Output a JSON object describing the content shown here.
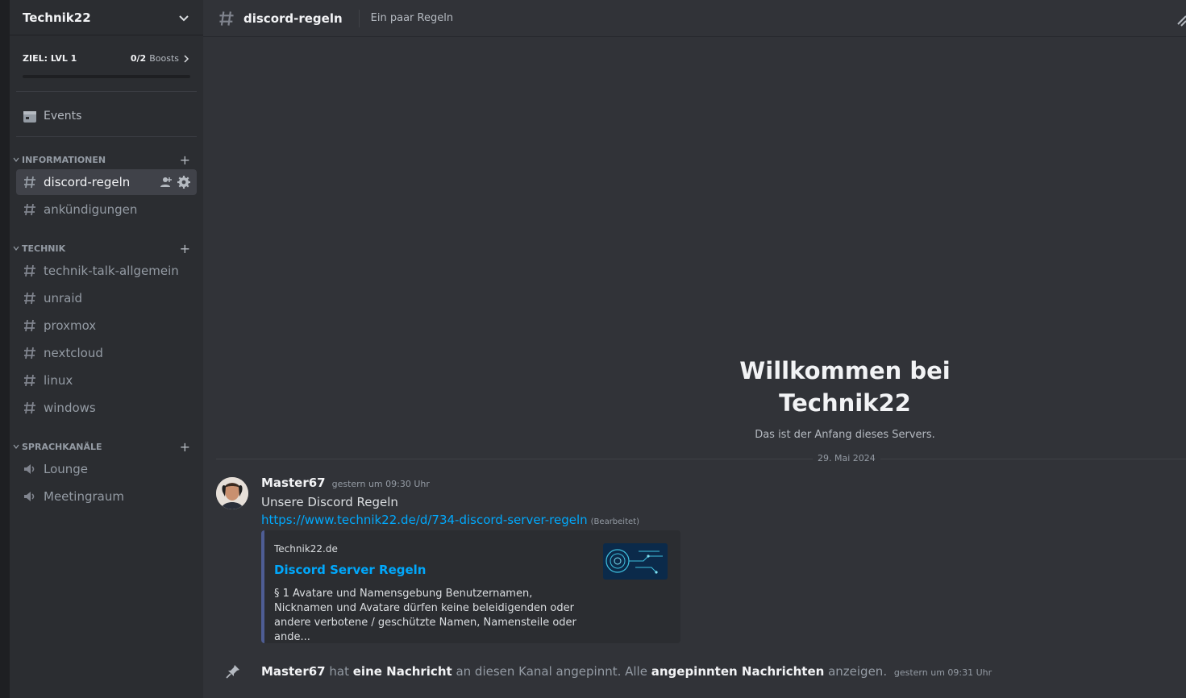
{
  "server": {
    "name": "Technik22",
    "boost_goal": "ZIEL: LVL 1",
    "boost_count": "0/2",
    "boost_unit": "Boosts",
    "boost_progress": 0
  },
  "sidebar": {
    "events_label": "Events",
    "categories": [
      {
        "name": "INFORMATIONEN",
        "channels": [
          {
            "name": "discord-regeln",
            "type": "text",
            "active": true
          },
          {
            "name": "ankündigungen",
            "type": "text",
            "active": false
          }
        ]
      },
      {
        "name": "TECHNIK",
        "channels": [
          {
            "name": "technik-talk-allgemein",
            "type": "text"
          },
          {
            "name": "unraid",
            "type": "text"
          },
          {
            "name": "proxmox",
            "type": "text"
          },
          {
            "name": "nextcloud",
            "type": "text"
          },
          {
            "name": "linux",
            "type": "text"
          },
          {
            "name": "windows",
            "type": "text"
          }
        ]
      },
      {
        "name": "SPRACHKANÄLE",
        "channels": [
          {
            "name": "Lounge",
            "type": "voice"
          },
          {
            "name": "Meetingraum",
            "type": "voice"
          }
        ]
      }
    ]
  },
  "header": {
    "channel": "discord-regeln",
    "topic": "Ein paar Regeln"
  },
  "welcome": {
    "line1": "Willkommen bei",
    "line2": "Technik22",
    "subtitle": "Das ist der Anfang dieses Servers."
  },
  "divider_date": "29. Mai 2024",
  "message": {
    "author": "Master67",
    "timestamp": "gestern um 09:30 Uhr",
    "text": "Unsere Discord Regeln",
    "link": "https://www.technik22.de/d/734-discord-server-regeln",
    "edited": "(Bearbeitet)",
    "embed": {
      "provider": "Technik22.de",
      "title": "Discord Server Regeln",
      "description": "§ 1 Avatare und Namensgebung Benutzernamen, Nicknamen und Avatare dürfen keine beleidigenden oder andere verbotene / geschützte Namen, Namensteile oder ande..."
    }
  },
  "pin": {
    "author": "Master67",
    "t1": "hat",
    "w1": "eine Nachricht",
    "t2": "an diesen Kanal angepinnt. Alle",
    "w2": "angepinnten Nachrichten",
    "t3": "anzeigen.",
    "timestamp": "gestern um 09:31 Uhr"
  },
  "colors": {
    "bg": "#313338",
    "sidebar": "#2b2d31",
    "link": "#00a8fc",
    "embed_border": "#4e5d94"
  }
}
